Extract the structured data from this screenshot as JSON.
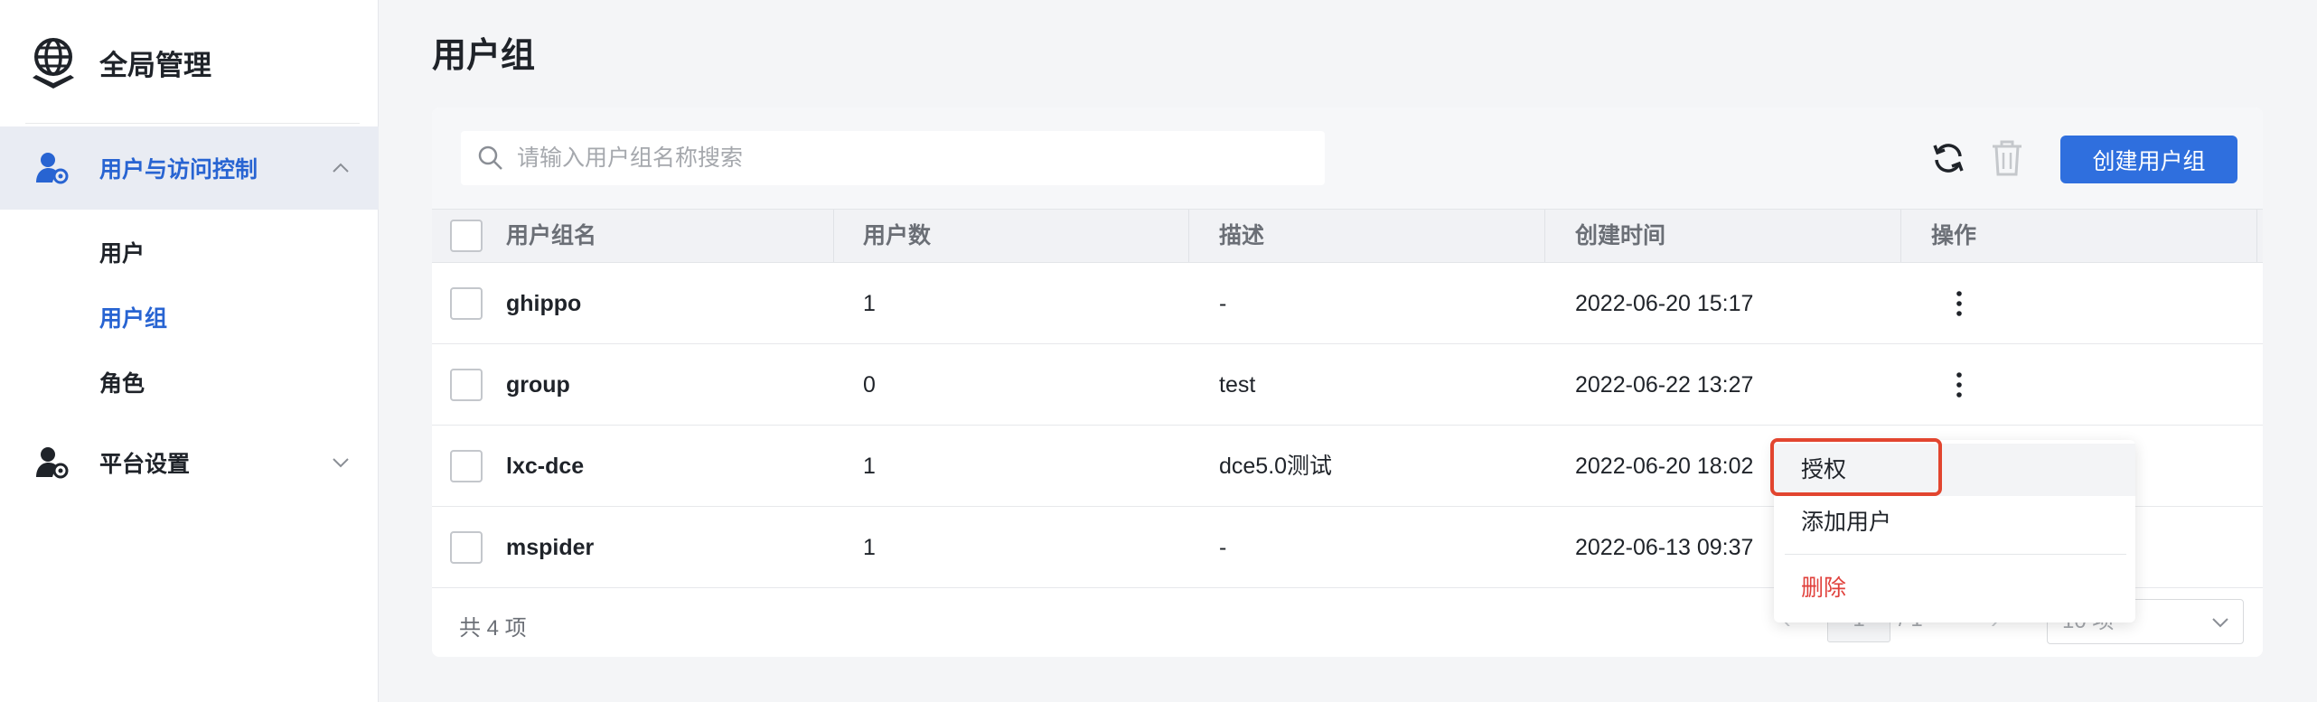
{
  "app": {
    "title": "全局管理"
  },
  "sidebar": {
    "groups": [
      {
        "label": "用户与访问控制",
        "expanded": true,
        "icon": "user-gear-icon"
      },
      {
        "label": "平台设置",
        "expanded": false,
        "icon": "user-gear-icon"
      }
    ],
    "items": [
      {
        "label": "用户",
        "active": false
      },
      {
        "label": "用户组",
        "active": true
      },
      {
        "label": "角色",
        "active": false
      }
    ]
  },
  "page": {
    "title": "用户组"
  },
  "toolbar": {
    "search_placeholder": "请输入用户组名称搜索",
    "refresh_icon": "refresh-icon",
    "delete_icon": "trash-icon",
    "create_label": "创建用户组"
  },
  "table": {
    "columns": [
      "用户组名",
      "用户数",
      "描述",
      "创建时间",
      "操作"
    ],
    "rows": [
      {
        "name": "ghippo",
        "users": "1",
        "desc": "-",
        "created": "2022-06-20 15:17"
      },
      {
        "name": "group",
        "users": "0",
        "desc": "test",
        "created": "2022-06-22 13:27"
      },
      {
        "name": "lxc-dce",
        "users": "1",
        "desc": "dce5.0测试",
        "created": "2022-06-20 18:02"
      },
      {
        "name": "mspider",
        "users": "1",
        "desc": "-",
        "created": "2022-06-13 09:37"
      }
    ]
  },
  "footer": {
    "total": "共 4 项",
    "page_current": "1",
    "page_total": "/ 1",
    "page_size": "10 项"
  },
  "menu": {
    "items": [
      {
        "label": "授权",
        "highlighted": true
      },
      {
        "label": "添加用户",
        "highlighted": false
      },
      {
        "label": "删除",
        "danger": true
      }
    ]
  },
  "colors": {
    "accent": "#2f6fde",
    "danger": "#e0403b",
    "highlight_border": "#e2452f"
  }
}
